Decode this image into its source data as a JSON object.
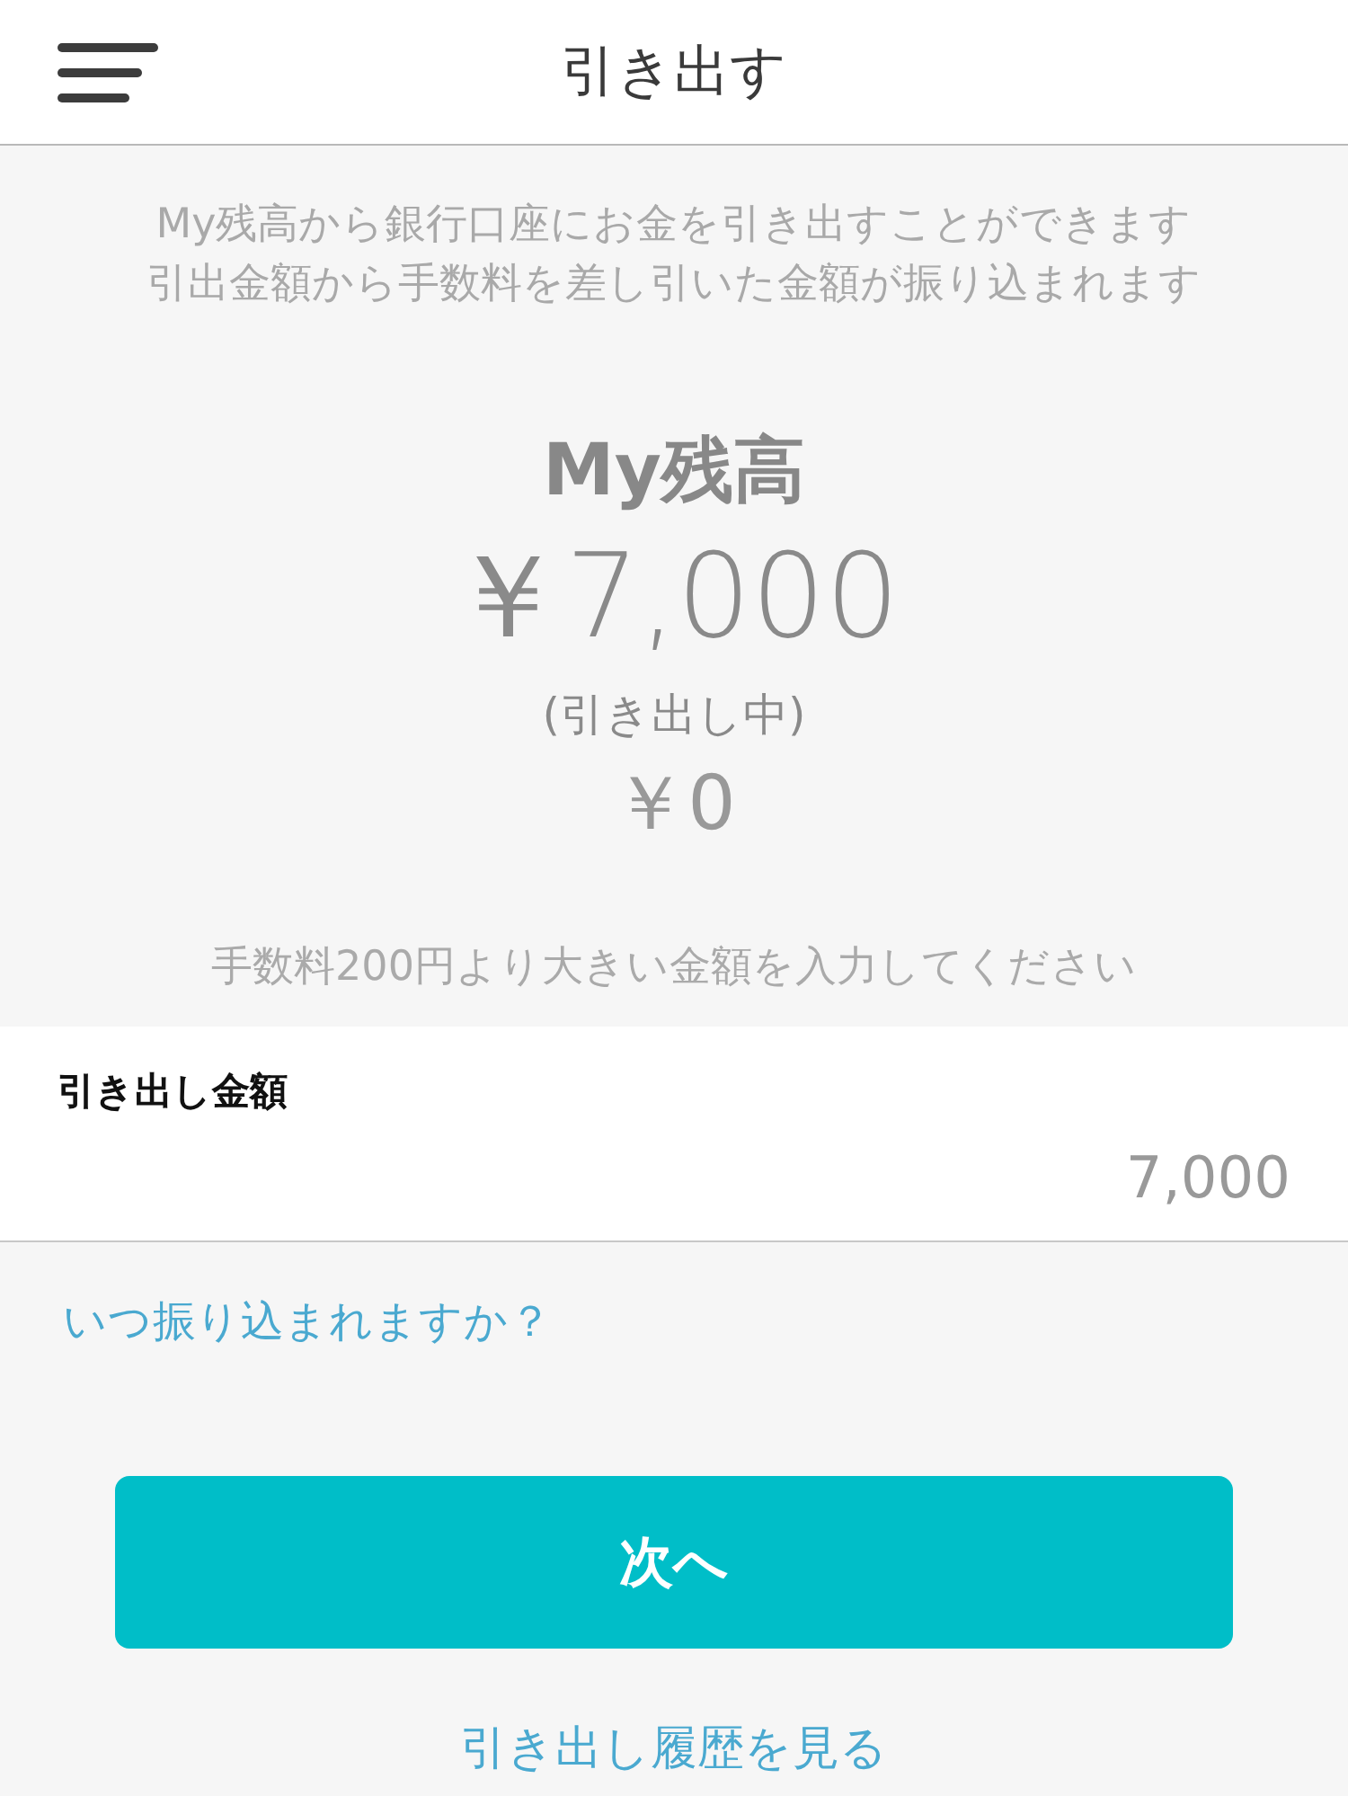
{
  "header": {
    "title": "引き出す"
  },
  "description": [
    "My残高から銀行口座にお金を引き出すことができます",
    "引出金額から手数料を差し引いた金額が振り込まれます"
  ],
  "balance": {
    "label": "My残高",
    "amount": "￥7,000",
    "pending_label": "(引き出し中)",
    "pending_amount": "￥0"
  },
  "hint": "手数料200円より大きい金額を入力してください",
  "amount_field": {
    "label": "引き出し金額",
    "value": "7,000"
  },
  "faq_link": "いつ振り込まれますか？",
  "next_button": "次へ",
  "history_link": "引き出し履歴を見る"
}
